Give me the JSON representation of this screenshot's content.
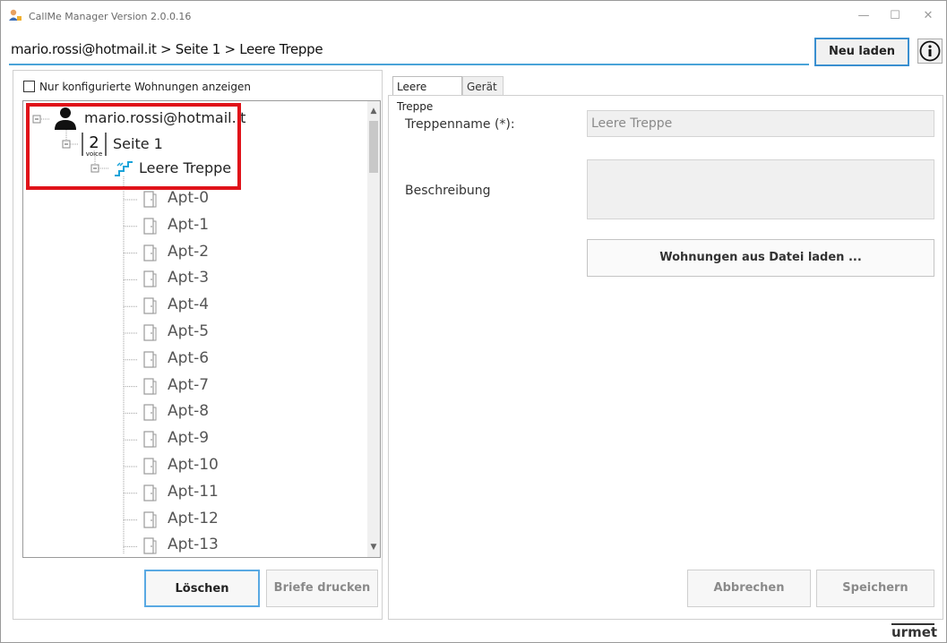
{
  "window": {
    "title": "CallMe Manager Version 2.0.0.16",
    "controls": {
      "minimize": "—",
      "maximize": "☐",
      "close": "✕"
    }
  },
  "header": {
    "breadcrumb": "mario.rossi@hotmail.it > Seite 1 > Leere Treppe",
    "reload_label": "Neu laden",
    "info_icon": "info-icon"
  },
  "left": {
    "checkbox_label": "Nur konfigurierte Wohnungen anzeigen",
    "tree": {
      "user": "mario.rossi@hotmail.it",
      "page": "Seite 1",
      "staircase": "Leere Treppe",
      "apartments": [
        "Apt-0",
        "Apt-1",
        "Apt-2",
        "Apt-3",
        "Apt-4",
        "Apt-5",
        "Apt-6",
        "Apt-7",
        "Apt-8",
        "Apt-9",
        "Apt-10",
        "Apt-11",
        "Apt-12",
        "Apt-13"
      ]
    },
    "delete_label": "Löschen",
    "print_label": "Briefe drucken"
  },
  "right": {
    "tabs": [
      {
        "label": "Leere Treppe"
      },
      {
        "label": "Gerät"
      }
    ],
    "name_label": "Treppenname (*):",
    "name_value": "Leere Treppe",
    "description_label": "Beschreibung",
    "description_value": "",
    "load_label": "Wohnungen aus Datei laden ...",
    "cancel_label": "Abbrechen",
    "save_label": "Speichern"
  },
  "brand": {
    "logo_text": "urmet"
  },
  "colors": {
    "accent": "#3a8fd0",
    "highlight": "#e0131a",
    "stairs": "#1aa3d9"
  }
}
